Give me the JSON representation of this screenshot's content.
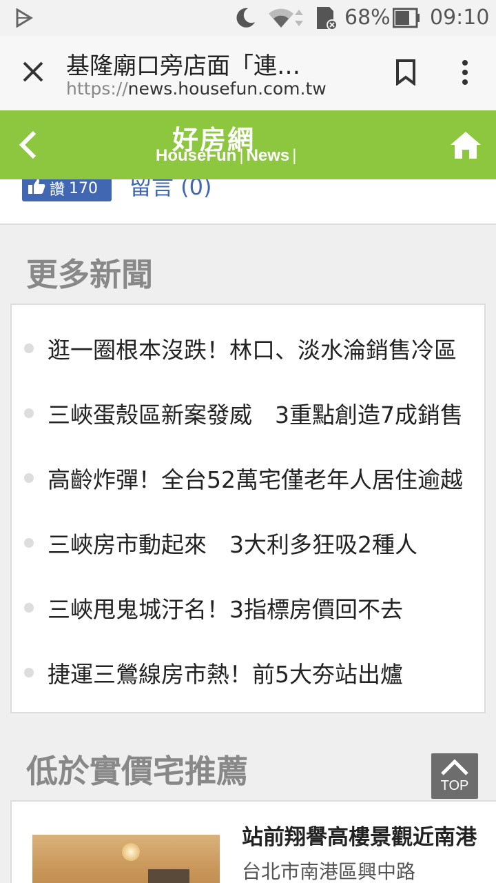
{
  "status_bar": {
    "battery_percent": "68%",
    "time": "09:10",
    "icons": [
      "play-store-icon",
      "moon-icon",
      "wifi-icon",
      "sd-card-icon",
      "battery-icon"
    ]
  },
  "browser": {
    "page_title": "基隆廟口旁店面「連…",
    "url_scheme": "https://",
    "url_host": "news.housefun.com.tw",
    "icons": [
      "close-icon",
      "bookmark-icon",
      "more-vert-icon"
    ]
  },
  "site_header": {
    "logo_cn": "好房網",
    "logo_en": "HouseFun",
    "logo_sep": "|",
    "logo_news": "News",
    "logo_sep2": "|",
    "brand_color": "#8dc63f",
    "icons": [
      "chevron-left-icon",
      "home-icon"
    ]
  },
  "social": {
    "like_label": "讚",
    "like_count": "170",
    "comment_label": "留言 (0)"
  },
  "more_news": {
    "title": "更多新聞",
    "items": [
      "逛一圈根本沒跌！林口、淡水淪銷售冷區",
      "三峽蛋殼區新案發威　3重點創造7成銷售",
      "高齡炸彈！全台52萬宅僅老年人居住逾越",
      "三峽房市動起來　3大利多狂吸2種人",
      "三峽甩鬼城汙名！3指標房價回不去",
      "捷運三鶯線房市熱！前5大夯站出爐"
    ]
  },
  "recommend": {
    "title": "低於實價宅推薦",
    "listing_name": "站前翔譽高樓景觀近南港",
    "listing_address": "台北市南港區興中路"
  },
  "top_button": {
    "label": "TOP"
  }
}
